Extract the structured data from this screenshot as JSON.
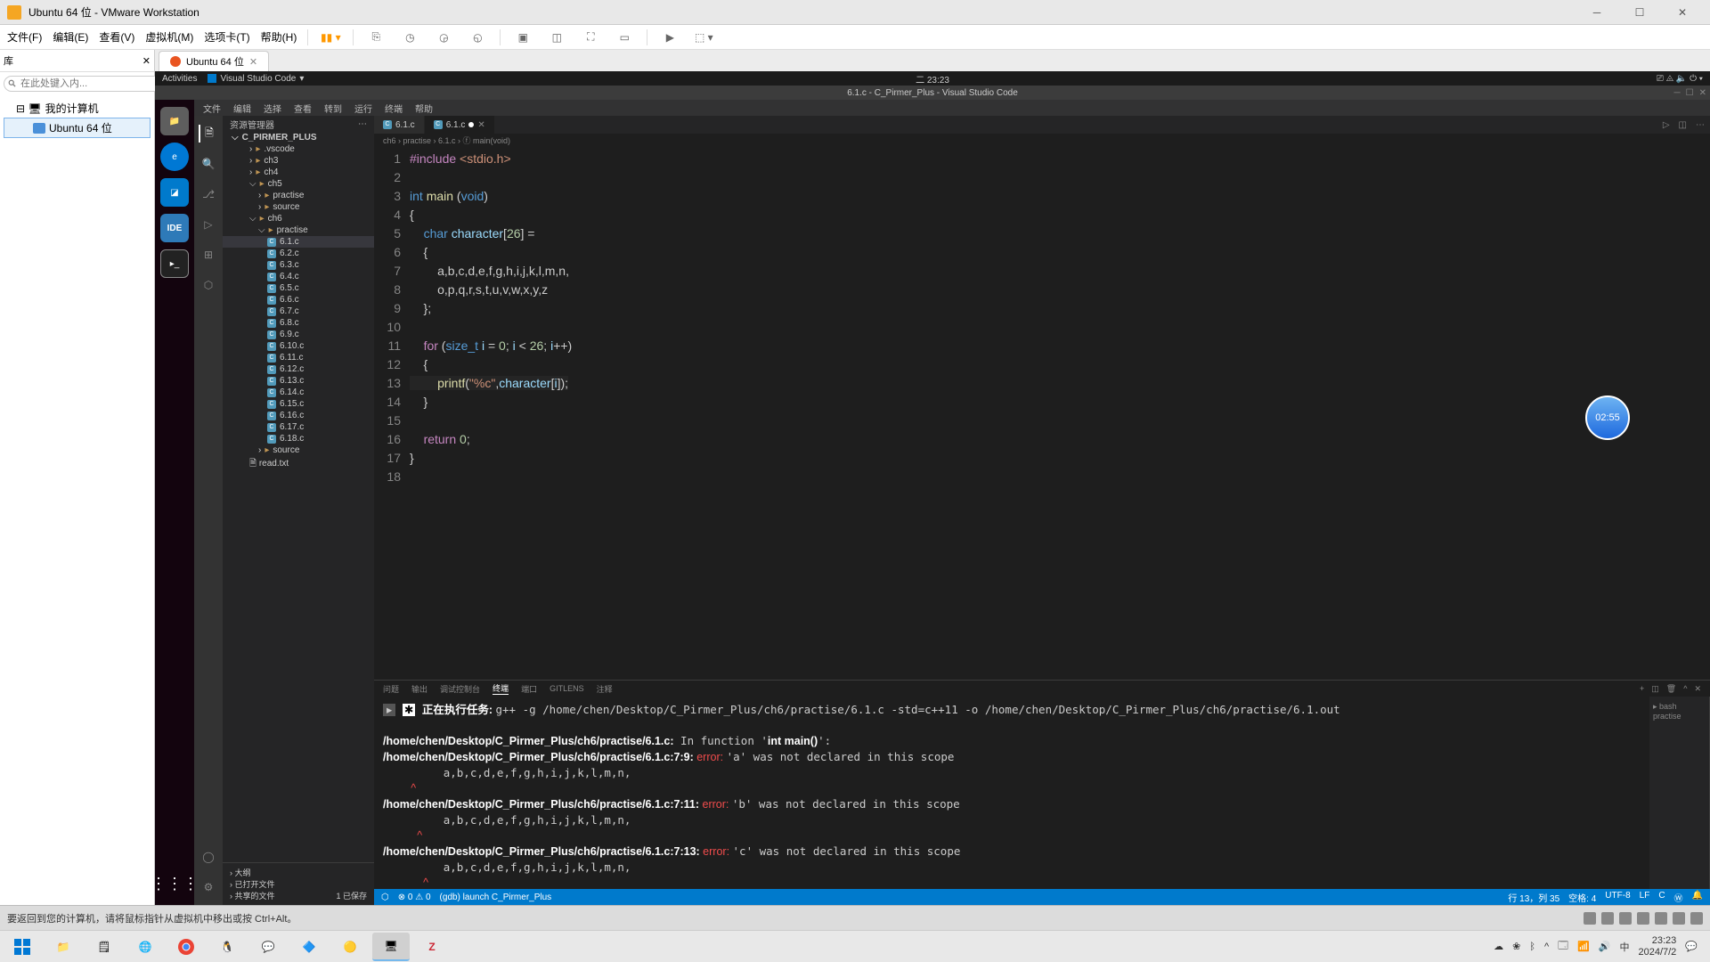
{
  "vmware": {
    "title": "Ubuntu 64 位 - VMware Workstation",
    "menu": [
      "文件(F)",
      "编辑(E)",
      "查看(V)",
      "虚拟机(M)",
      "选项卡(T)",
      "帮助(H)"
    ],
    "lib_title": "库",
    "search_placeholder": "在此处键入内...",
    "tree_root": "我的计算机",
    "tree_item": "Ubuntu 64 位",
    "tab": "Ubuntu 64 位",
    "status_hint": "要返回到您的计算机，请将鼠标指针从虚拟机中移出或按 Ctrl+Alt。"
  },
  "ubuntu": {
    "activities": "Activities",
    "app_label": "Visual Studio Code",
    "clock": "二 23:23"
  },
  "vscode": {
    "title": "6.1.c - C_Pirmer_Plus - Visual Studio Code",
    "menu": [
      "文件",
      "编辑",
      "选择",
      "查看",
      "转到",
      "运行",
      "终端",
      "帮助"
    ],
    "explorer_title": "资源管理器",
    "project": "C_PIRMER_PLUS",
    "tree": [
      {
        "l": 2,
        "t": "folder",
        "n": ".vscode"
      },
      {
        "l": 2,
        "t": "folder",
        "n": "ch3"
      },
      {
        "l": 2,
        "t": "folder",
        "n": "ch4"
      },
      {
        "l": 2,
        "t": "folder",
        "n": "ch5",
        "open": true
      },
      {
        "l": 3,
        "t": "folder",
        "n": "practise"
      },
      {
        "l": 3,
        "t": "folder",
        "n": "source"
      },
      {
        "l": 2,
        "t": "folder",
        "n": "ch6",
        "open": true
      },
      {
        "l": 3,
        "t": "folder",
        "n": "practise",
        "open": true
      },
      {
        "l": 4,
        "t": "c",
        "n": "6.1.c",
        "sel": true
      },
      {
        "l": 4,
        "t": "c",
        "n": "6.2.c"
      },
      {
        "l": 4,
        "t": "c",
        "n": "6.3.c"
      },
      {
        "l": 4,
        "t": "c",
        "n": "6.4.c"
      },
      {
        "l": 4,
        "t": "c",
        "n": "6.5.c"
      },
      {
        "l": 4,
        "t": "c",
        "n": "6.6.c"
      },
      {
        "l": 4,
        "t": "c",
        "n": "6.7.c"
      },
      {
        "l": 4,
        "t": "c",
        "n": "6.8.c"
      },
      {
        "l": 4,
        "t": "c",
        "n": "6.9.c"
      },
      {
        "l": 4,
        "t": "c",
        "n": "6.10.c"
      },
      {
        "l": 4,
        "t": "c",
        "n": "6.11.c"
      },
      {
        "l": 4,
        "t": "c",
        "n": "6.12.c"
      },
      {
        "l": 4,
        "t": "c",
        "n": "6.13.c"
      },
      {
        "l": 4,
        "t": "c",
        "n": "6.14.c"
      },
      {
        "l": 4,
        "t": "c",
        "n": "6.15.c"
      },
      {
        "l": 4,
        "t": "c",
        "n": "6.16.c"
      },
      {
        "l": 4,
        "t": "c",
        "n": "6.17.c"
      },
      {
        "l": 4,
        "t": "c",
        "n": "6.18.c"
      },
      {
        "l": 3,
        "t": "folder",
        "n": "source"
      },
      {
        "l": 2,
        "t": "file",
        "n": "read.txt"
      }
    ],
    "outline_title": "大纲",
    "outline_sub1": "已打开文件",
    "outline_sub2": "共享的文件",
    "outline_count": "1 已保存",
    "tab_name": "6.1.c",
    "crumb": "ch6 › practise › 6.1.c › ⓕ main(void)",
    "code_lines": 18,
    "panel_tabs": [
      "问题",
      "输出",
      "调试控制台",
      "终端",
      "端口",
      "GITLENS",
      "注释"
    ],
    "panel_active": "终端",
    "term_right": "bash practise",
    "status_left_launch": "(gdb) launch C_Pirmer_Plus",
    "status_right": [
      "行 13，列 35",
      "空格: 4",
      "UTF-8",
      "LF",
      "C",
      "Ⓦ"
    ],
    "timer": "02:55"
  },
  "terminal": {
    "task_prefix": "正在执行任务: ",
    "task_cmd": "g++ -g /home/chen/Desktop/C_Pirmer_Plus/ch6/practise/6.1.c -std=c++11 -o /home/chen/Desktop/C_Pirmer_Plus/ch6/practise/6.1.out",
    "errors": [
      {
        "file": "/home/chen/Desktop/C_Pirmer_Plus/ch6/practise/6.1.c:",
        "func": " In function '",
        "sig": "int main()",
        "funcend": "':"
      },
      {
        "file": "/home/chen/Desktop/C_Pirmer_Plus/ch6/practise/6.1.c:7:9:",
        "tag": " error: ",
        "msg": "'a' was not declared in this scope",
        "src": "         a,b,c,d,e,f,g,h,i,j,k,l,m,n,",
        "caret": "         ^"
      },
      {
        "file": "/home/chen/Desktop/C_Pirmer_Plus/ch6/practise/6.1.c:7:11:",
        "tag": " error: ",
        "msg": "'b' was not declared in this scope",
        "src": "         a,b,c,d,e,f,g,h,i,j,k,l,m,n,",
        "caret": "           ^"
      },
      {
        "file": "/home/chen/Desktop/C_Pirmer_Plus/ch6/practise/6.1.c:7:13:",
        "tag": " error: ",
        "msg": "'c' was not declared in this scope",
        "src": "         a,b,c,d,e,f,g,h,i,j,k,l,m,n,",
        "caret": "             ^"
      }
    ]
  },
  "windows": {
    "time": "23:23",
    "date": "2024/7/2",
    "ime": "中"
  }
}
